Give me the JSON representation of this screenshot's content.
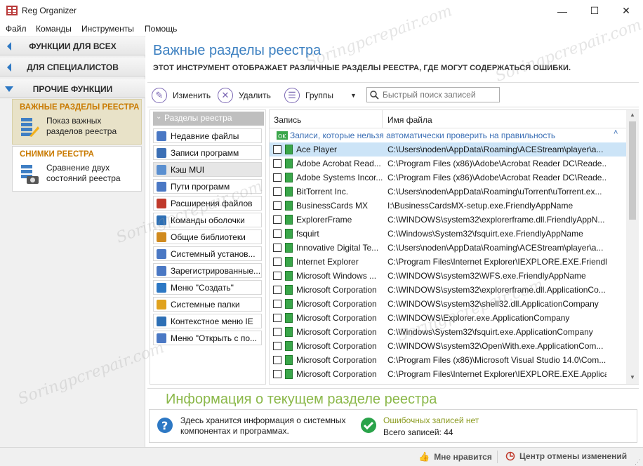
{
  "window": {
    "title": "Reg Organizer",
    "minimize": "—",
    "maximize": "☐",
    "close": "✕"
  },
  "menu": [
    "Файл",
    "Команды",
    "Инструменты",
    "Помощь"
  ],
  "sidebar": {
    "sections": [
      {
        "label": "ФУНКЦИИ ДЛЯ ВСЕХ",
        "expanded": false
      },
      {
        "label": "ДЛЯ СПЕЦИАЛИСТОВ",
        "expanded": false
      },
      {
        "label": "ПРОЧИЕ ФУНКЦИИ",
        "expanded": true
      }
    ],
    "cards": [
      {
        "title": "ВАЖНЫЕ РАЗДЕЛЫ РЕЕСТРА",
        "text": "Показ важных разделов реестра",
        "icon": "registry-sections-icon",
        "selected": true
      },
      {
        "title": "СНИМКИ РЕЕСТРА",
        "text": "Сравнение двух состояний реестра",
        "icon": "registry-snapshot-icon",
        "selected": false
      }
    ]
  },
  "main": {
    "title": "Важные разделы реестра",
    "description": "ЭТОТ ИНСТРУМЕНТ ОТОБРАЖАЕТ РАЗЛИЧНЫЕ РАЗДЕЛЫ РЕЕСТРА, ГДЕ МОГУТ СОДЕРЖАТЬСЯ ОШИБКИ."
  },
  "toolbar": {
    "edit": "Изменить",
    "delete": "Удалить",
    "groups": "Группы",
    "search_placeholder": "Быстрый поиск записей"
  },
  "sections_list": {
    "header": "Разделы реестра",
    "items": [
      {
        "label": "Недавние файлы",
        "icon": "recent-files-icon",
        "selected": false
      },
      {
        "label": "Записи программ",
        "icon": "program-entries-icon",
        "selected": false
      },
      {
        "label": "Кэш MUI",
        "icon": "mui-cache-icon",
        "selected": true
      },
      {
        "label": "Пути программ",
        "icon": "program-paths-icon",
        "selected": false
      },
      {
        "label": "Расширения файлов",
        "icon": "file-extensions-icon",
        "selected": false
      },
      {
        "label": "Команды оболочки",
        "icon": "shell-commands-icon",
        "selected": false
      },
      {
        "label": "Общие библиотеки",
        "icon": "shared-libraries-icon",
        "selected": false
      },
      {
        "label": "Системный установ...",
        "icon": "system-installer-icon",
        "selected": false
      },
      {
        "label": "Зарегистрированные...",
        "icon": "registered-icon",
        "selected": false
      },
      {
        "label": "Меню \"Создать\"",
        "icon": "new-menu-icon",
        "selected": false
      },
      {
        "label": "Системные папки",
        "icon": "system-folders-icon",
        "selected": false
      },
      {
        "label": "Контекстное меню IE",
        "icon": "ie-context-menu-icon",
        "selected": false
      },
      {
        "label": "Меню \"Открыть с по...",
        "icon": "open-with-menu-icon",
        "selected": false
      }
    ]
  },
  "table": {
    "columns": [
      "Запись",
      "Имя файла"
    ],
    "group_label": "Записи, которые нельзя автоматически проверить на правильность",
    "rows": [
      {
        "record": "Ace Player",
        "file": "C:\\Users\\noden\\AppData\\Roaming\\ACEStream\\player\\a...",
        "selected": true
      },
      {
        "record": "Adobe Acrobat Read...",
        "file": "C:\\Program Files (x86)\\Adobe\\Acrobat Reader DC\\Reade...",
        "selected": false
      },
      {
        "record": "Adobe Systems Incor...",
        "file": "C:\\Program Files (x86)\\Adobe\\Acrobat Reader DC\\Reade...",
        "selected": false
      },
      {
        "record": "BitTorrent Inc.",
        "file": "C:\\Users\\noden\\AppData\\Roaming\\uTorrent\\uTorrent.ex...",
        "selected": false
      },
      {
        "record": "BusinessCards MX",
        "file": "I:\\BusinessCardsMX-setup.exe.FriendlyAppName",
        "selected": false
      },
      {
        "record": "ExplorerFrame",
        "file": "C:\\WINDOWS\\system32\\explorerframe.dll.FriendlyAppN...",
        "selected": false
      },
      {
        "record": "fsquirt",
        "file": "C:\\Windows\\System32\\fsquirt.exe.FriendlyAppName",
        "selected": false
      },
      {
        "record": "Innovative Digital Te...",
        "file": "C:\\Users\\noden\\AppData\\Roaming\\ACEStream\\player\\a...",
        "selected": false
      },
      {
        "record": "Internet Explorer",
        "file": "C:\\Program Files\\Internet Explorer\\IEXPLORE.EXE.Friendl...",
        "selected": false
      },
      {
        "record": "Microsoft Windows ...",
        "file": "C:\\WINDOWS\\system32\\WFS.exe.FriendlyAppName",
        "selected": false
      },
      {
        "record": "Microsoft Corporation",
        "file": "C:\\WINDOWS\\system32\\explorerframe.dll.ApplicationCo...",
        "selected": false
      },
      {
        "record": "Microsoft Corporation",
        "file": "C:\\WINDOWS\\system32\\shell32.dll.ApplicationCompany",
        "selected": false
      },
      {
        "record": "Microsoft Corporation",
        "file": "C:\\WINDOWS\\Explorer.exe.ApplicationCompany",
        "selected": false
      },
      {
        "record": "Microsoft Corporation",
        "file": "C:\\Windows\\System32\\fsquirt.exe.ApplicationCompany",
        "selected": false
      },
      {
        "record": "Microsoft Corporation",
        "file": "C:\\WINDOWS\\system32\\OpenWith.exe.ApplicationCom...",
        "selected": false
      },
      {
        "record": "Microsoft Corporation",
        "file": "C:\\Program Files (x86)\\Microsoft Visual Studio 14.0\\Com...",
        "selected": false
      },
      {
        "record": "Microsoft Corporation",
        "file": "C:\\Program Files\\Internet Explorer\\IEXPLORE.EXE.Applica...",
        "selected": false
      }
    ]
  },
  "info": {
    "title": "Информация о текущем разделе реестра",
    "description": "Здесь хранится информация о системных компонентах и программах.",
    "status": "Ошибочных записей нет",
    "total": "Всего записей: 44"
  },
  "statusbar": {
    "like": "Мне нравится",
    "undo_center": "Центр отмены изменений"
  },
  "watermark": "Soringpcrepair.com",
  "colors": {
    "accent_blue": "#3b7fc0",
    "info_green": "#8bb84a",
    "card_title": "#c97a00",
    "selection": "#cce4f7"
  }
}
